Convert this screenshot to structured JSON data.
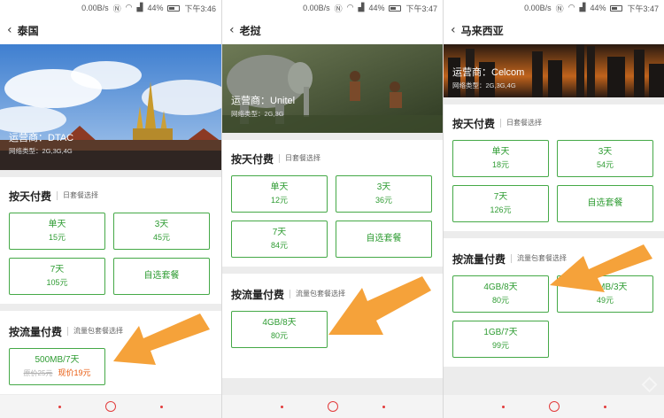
{
  "status": {
    "speed": "0.00B/s",
    "battery": "44%",
    "icons": [
      "nfc-icon",
      "wifi-icon",
      "signal-icon",
      "battery-icon"
    ]
  },
  "panels": [
    {
      "title": "泰国",
      "operator": "运营商：DTAC",
      "network": "网络类型：2G,3G,4G",
      "day_section": "按天付费",
      "day_hint": "日套餐选择",
      "flow_section": "按流量付费",
      "flow_hint": "流量包套餐选择",
      "time": "下午3:46",
      "day_plans": [
        {
          "name": "单天",
          "price": "15元"
        },
        {
          "name": "3天",
          "price": "45元"
        },
        {
          "name": "7天",
          "price": "105元"
        },
        {
          "name": "自选套餐"
        }
      ],
      "flow_plans": [
        {
          "name": "500MB/7天",
          "old": "原价25元",
          "now": "现价19元"
        }
      ]
    },
    {
      "title": "老挝",
      "operator": "运营商：Unitel",
      "network": "网络类型：2G,3G",
      "day_section": "按天付费",
      "day_hint": "日套餐选择",
      "flow_section": "按流量付费",
      "flow_hint": "流量包套餐选择",
      "time": "下午3:47",
      "day_plans": [
        {
          "name": "单天",
          "price": "12元"
        },
        {
          "name": "3天",
          "price": "36元"
        },
        {
          "name": "7天",
          "price": "84元"
        },
        {
          "name": "自选套餐"
        }
      ],
      "flow_plans": [
        {
          "name": "4GB/8天",
          "price": "80元"
        }
      ]
    },
    {
      "title": "马来西亚",
      "operator": "运营商：Celcom",
      "network": "网络类型：2G,3G,4G",
      "day_section": "按天付费",
      "day_hint": "日套餐选择",
      "flow_section": "按流量付费",
      "flow_hint": "流量包套餐选择",
      "time": "下午3:47",
      "day_plans": [
        {
          "name": "单天",
          "price": "18元"
        },
        {
          "name": "3天",
          "price": "54元"
        },
        {
          "name": "7天",
          "price": "126元"
        },
        {
          "name": "自选套餐"
        }
      ],
      "flow_plans": [
        {
          "name": "4GB/8天",
          "price": "80元"
        },
        {
          "name": "300MB/3天",
          "price": "49元"
        },
        {
          "name": "1GB/7天",
          "price": "99元"
        }
      ]
    }
  ],
  "colors": {
    "accent": "#45a947",
    "arrow": "#f5a23a",
    "price_now": "#e8590c"
  }
}
